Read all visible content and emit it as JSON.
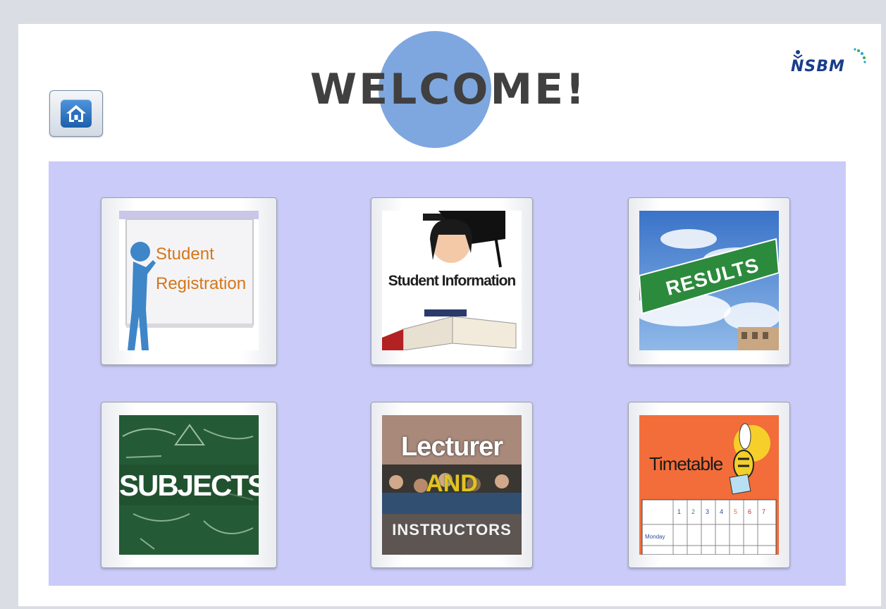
{
  "header": {
    "title": "WELCOME!",
    "logo_text": "NSBM",
    "home_icon": "home-icon"
  },
  "tiles": [
    {
      "id": "student-registration",
      "label_line1": "Student",
      "label_line2": "Registration"
    },
    {
      "id": "student-information",
      "label": "Student Information"
    },
    {
      "id": "results",
      "label": "RESULTS"
    },
    {
      "id": "subjects",
      "label": "SUBJECTS"
    },
    {
      "id": "lecturer",
      "label_line1": "Lecturer",
      "label_line2": "AND",
      "label_line3": "INSTRUCTORS"
    },
    {
      "id": "timetable",
      "label": "Timetable",
      "days": [
        "1",
        "2",
        "3",
        "4",
        "5",
        "6",
        "7"
      ],
      "row_label": "Monday"
    }
  ],
  "colors": {
    "page_bg": "#dadde3",
    "panel_bg": "#cacbf8",
    "welcome_circle": "#7ea7e0",
    "welcome_text": "#404040",
    "home_button": "#2a6fc0"
  }
}
